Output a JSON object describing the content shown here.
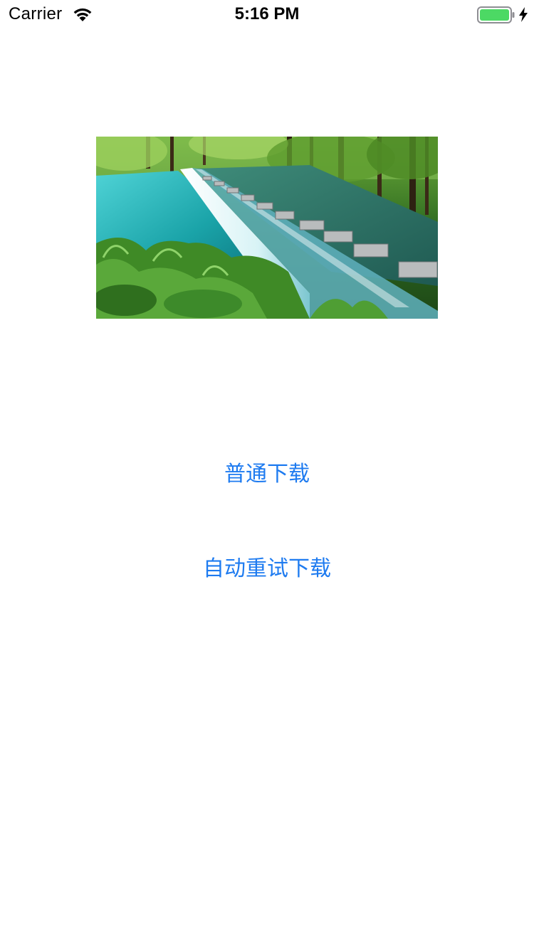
{
  "status_bar": {
    "carrier": "Carrier",
    "time": "5:16 PM",
    "wifi_icon": "wifi-icon",
    "battery_icon": "battery-icon",
    "charging_icon": "bolt-icon",
    "battery_color": "#4cd964"
  },
  "hero_image": {
    "subject": "waterfall-weir-with-stepping-stones-in-forest"
  },
  "buttons": {
    "normal_download": "普通下载",
    "auto_retry_download": "自动重试下载"
  },
  "colors": {
    "accent": "#1e7bf0",
    "background": "#ffffff"
  }
}
